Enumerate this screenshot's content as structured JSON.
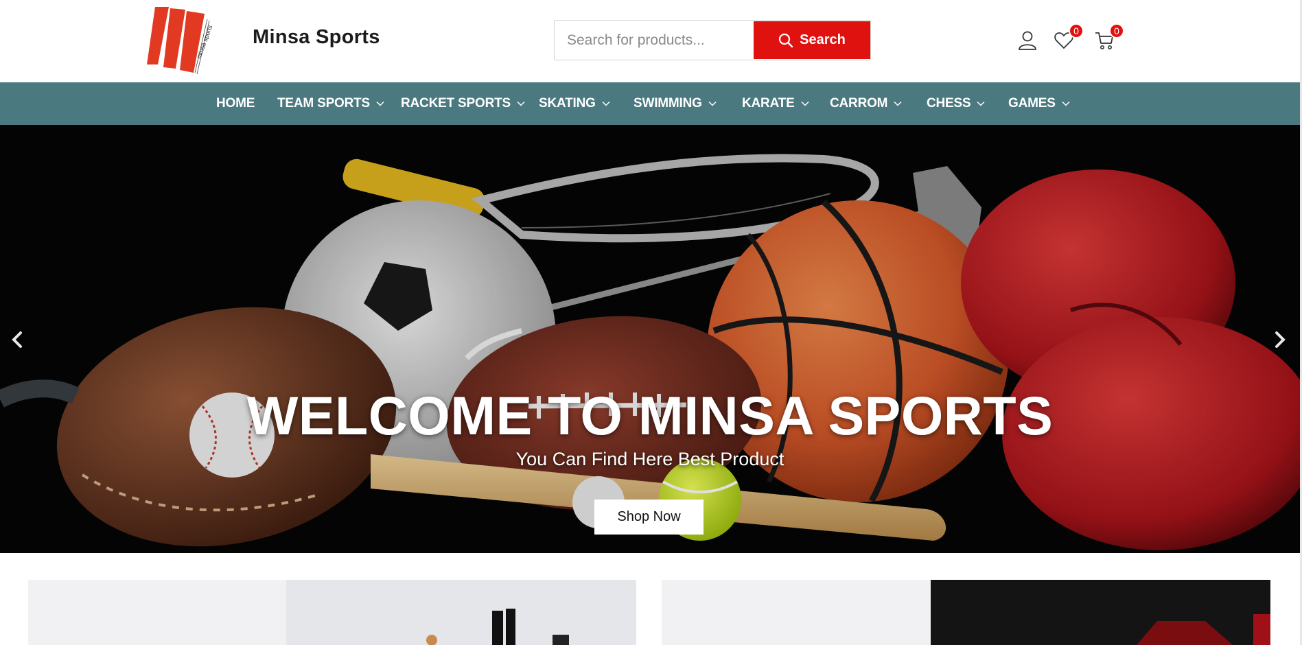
{
  "brand": {
    "name": "Minsa Sports",
    "logo_text": "minsa sports"
  },
  "search": {
    "placeholder": "Search for products...",
    "button_label": "Search"
  },
  "header_icons": {
    "wishlist_count": "0",
    "cart_count": "0"
  },
  "nav": {
    "items": [
      {
        "label": "HOME"
      },
      {
        "label": "TEAM SPORTS"
      },
      {
        "label": "RACKET SPORTS"
      },
      {
        "label": "SKATING"
      },
      {
        "label": "SWIMMING"
      },
      {
        "label": "KARATE"
      },
      {
        "label": "CARROM"
      },
      {
        "label": "CHESS"
      },
      {
        "label": "GAMES"
      }
    ]
  },
  "hero": {
    "title": "WELCOME TO MINSA SPORTS",
    "subtitle": "You Can Find Here Best Product",
    "cta_label": "Shop Now"
  },
  "colors": {
    "accent": "#e0120f",
    "nav_bg": "#4a7980",
    "hero_bg": "#000000"
  }
}
